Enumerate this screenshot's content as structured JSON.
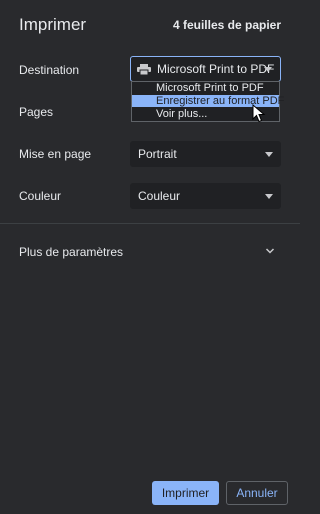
{
  "header": {
    "title": "Imprimer",
    "sheet_count": "4 feuilles de papier"
  },
  "destination": {
    "label": "Destination",
    "value": "Microsoft Print to PDF",
    "icon": "printer-icon",
    "dropdown_options": [
      "Microsoft Print to PDF",
      "Enregistrer au format PDF",
      "Voir plus..."
    ],
    "highlighted_option": "Enregistrer au format PDF"
  },
  "pages": {
    "label": "Pages"
  },
  "layout": {
    "label": "Mise en page",
    "value": "Portrait"
  },
  "color": {
    "label": "Couleur",
    "value": "Couleur"
  },
  "more_settings": {
    "label": "Plus de paramètres"
  },
  "actions": {
    "print_label": "Imprimer",
    "cancel_label": "Annuler"
  },
  "colors": {
    "background": "#292a2d",
    "field": "#202124",
    "accent": "#8ab4f8",
    "text": "#e8eaed"
  }
}
